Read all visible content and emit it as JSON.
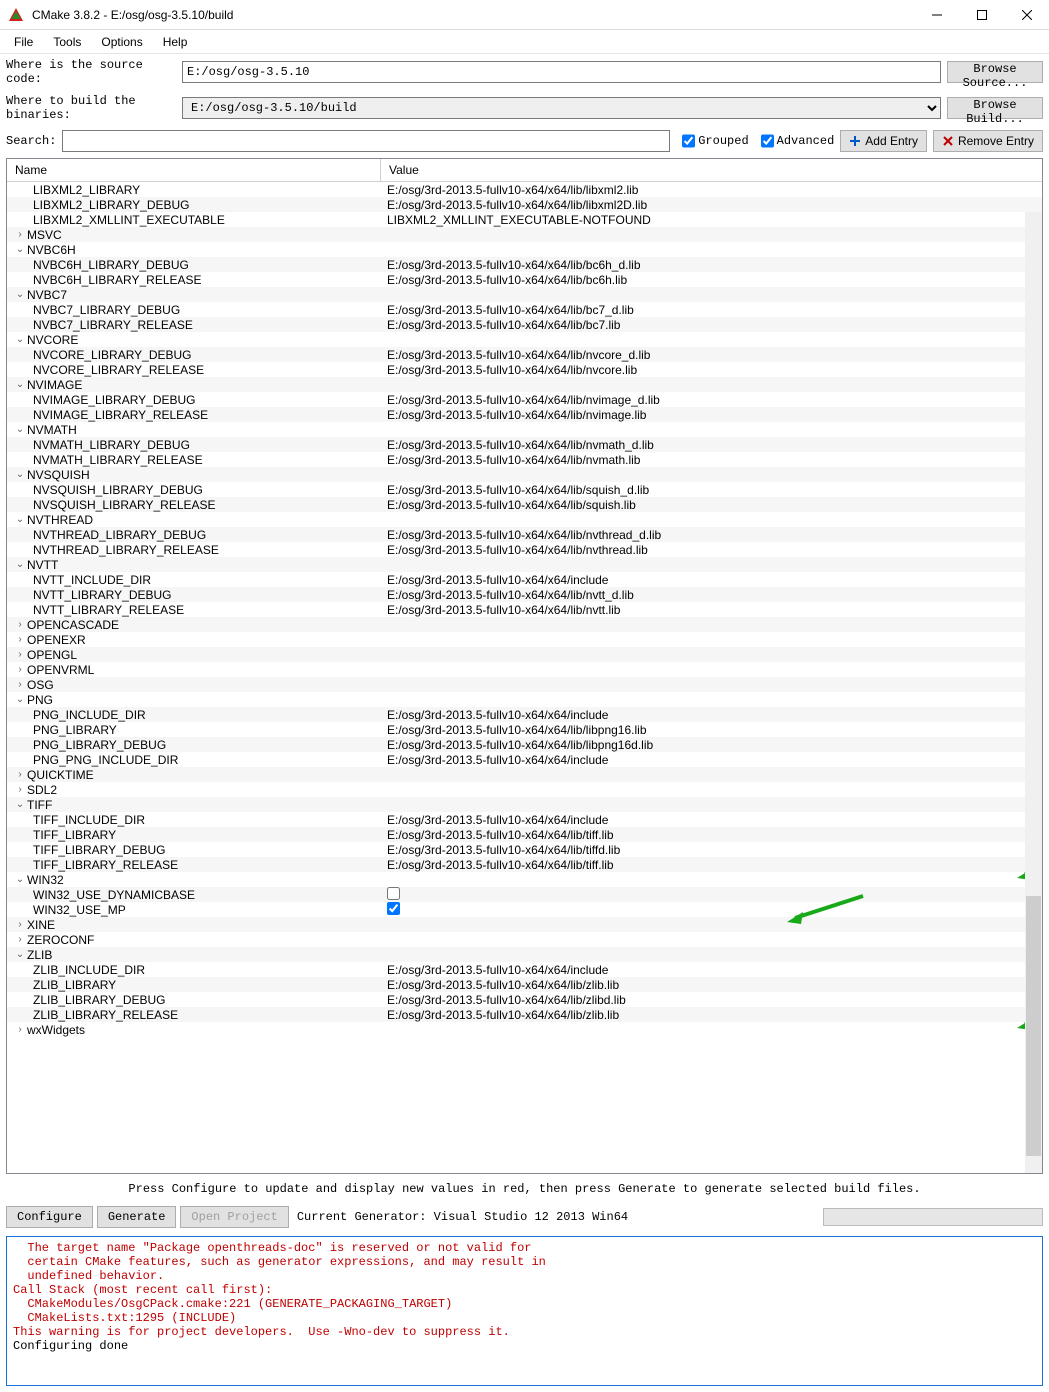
{
  "title": "CMake 3.8.2 - E:/osg/osg-3.5.10/build",
  "menu": [
    "File",
    "Tools",
    "Options",
    "Help"
  ],
  "sourceLabel": "Where is the source code:",
  "sourcePath": "E:/osg/osg-3.5.10",
  "browseSource": "Browse Source...",
  "buildLabel": "Where to build the binaries:",
  "buildPath": "E:/osg/osg-3.5.10/build",
  "browseBuild": "Browse Build...",
  "searchLabel": "Search:",
  "grouped": "Grouped",
  "advanced": "Advanced",
  "addEntry": "Add Entry",
  "removeEntry": "Remove Entry",
  "colName": "Name",
  "colValue": "Value",
  "rows": [
    {
      "indent": 2,
      "name": "LIBXML2_LIBRARY",
      "value": "E:/osg/3rd-2013.5-fullv10-x64/x64/lib/libxml2.lib"
    },
    {
      "indent": 2,
      "name": "LIBXML2_LIBRARY_DEBUG",
      "value": "E:/osg/3rd-2013.5-fullv10-x64/x64/lib/libxml2D.lib"
    },
    {
      "indent": 2,
      "name": "LIBXML2_XMLLINT_EXECUTABLE",
      "value": "LIBXML2_XMLLINT_EXECUTABLE-NOTFOUND"
    },
    {
      "indent": 1,
      "chevron": "right",
      "name": "MSVC",
      "value": ""
    },
    {
      "indent": 1,
      "chevron": "down",
      "name": "NVBC6H",
      "value": ""
    },
    {
      "indent": 2,
      "name": "NVBC6H_LIBRARY_DEBUG",
      "value": "E:/osg/3rd-2013.5-fullv10-x64/x64/lib/bc6h_d.lib"
    },
    {
      "indent": 2,
      "name": "NVBC6H_LIBRARY_RELEASE",
      "value": "E:/osg/3rd-2013.5-fullv10-x64/x64/lib/bc6h.lib"
    },
    {
      "indent": 1,
      "chevron": "down",
      "name": "NVBC7",
      "value": ""
    },
    {
      "indent": 2,
      "name": "NVBC7_LIBRARY_DEBUG",
      "value": "E:/osg/3rd-2013.5-fullv10-x64/x64/lib/bc7_d.lib"
    },
    {
      "indent": 2,
      "name": "NVBC7_LIBRARY_RELEASE",
      "value": "E:/osg/3rd-2013.5-fullv10-x64/x64/lib/bc7.lib"
    },
    {
      "indent": 1,
      "chevron": "down",
      "name": "NVCORE",
      "value": ""
    },
    {
      "indent": 2,
      "name": "NVCORE_LIBRARY_DEBUG",
      "value": "E:/osg/3rd-2013.5-fullv10-x64/x64/lib/nvcore_d.lib"
    },
    {
      "indent": 2,
      "name": "NVCORE_LIBRARY_RELEASE",
      "value": "E:/osg/3rd-2013.5-fullv10-x64/x64/lib/nvcore.lib"
    },
    {
      "indent": 1,
      "chevron": "down",
      "name": "NVIMAGE",
      "value": ""
    },
    {
      "indent": 2,
      "name": "NVIMAGE_LIBRARY_DEBUG",
      "value": "E:/osg/3rd-2013.5-fullv10-x64/x64/lib/nvimage_d.lib"
    },
    {
      "indent": 2,
      "name": "NVIMAGE_LIBRARY_RELEASE",
      "value": "E:/osg/3rd-2013.5-fullv10-x64/x64/lib/nvimage.lib"
    },
    {
      "indent": 1,
      "chevron": "down",
      "name": "NVMATH",
      "value": ""
    },
    {
      "indent": 2,
      "name": "NVMATH_LIBRARY_DEBUG",
      "value": "E:/osg/3rd-2013.5-fullv10-x64/x64/lib/nvmath_d.lib"
    },
    {
      "indent": 2,
      "name": "NVMATH_LIBRARY_RELEASE",
      "value": "E:/osg/3rd-2013.5-fullv10-x64/x64/lib/nvmath.lib"
    },
    {
      "indent": 1,
      "chevron": "down",
      "name": "NVSQUISH",
      "value": ""
    },
    {
      "indent": 2,
      "name": "NVSQUISH_LIBRARY_DEBUG",
      "value": "E:/osg/3rd-2013.5-fullv10-x64/x64/lib/squish_d.lib"
    },
    {
      "indent": 2,
      "name": "NVSQUISH_LIBRARY_RELEASE",
      "value": "E:/osg/3rd-2013.5-fullv10-x64/x64/lib/squish.lib"
    },
    {
      "indent": 1,
      "chevron": "down",
      "name": "NVTHREAD",
      "value": ""
    },
    {
      "indent": 2,
      "name": "NVTHREAD_LIBRARY_DEBUG",
      "value": "E:/osg/3rd-2013.5-fullv10-x64/x64/lib/nvthread_d.lib"
    },
    {
      "indent": 2,
      "name": "NVTHREAD_LIBRARY_RELEASE",
      "value": "E:/osg/3rd-2013.5-fullv10-x64/x64/lib/nvthread.lib"
    },
    {
      "indent": 1,
      "chevron": "down",
      "name": "NVTT",
      "value": ""
    },
    {
      "indent": 2,
      "name": "NVTT_INCLUDE_DIR",
      "value": "E:/osg/3rd-2013.5-fullv10-x64/x64/include"
    },
    {
      "indent": 2,
      "name": "NVTT_LIBRARY_DEBUG",
      "value": "E:/osg/3rd-2013.5-fullv10-x64/x64/lib/nvtt_d.lib"
    },
    {
      "indent": 2,
      "name": "NVTT_LIBRARY_RELEASE",
      "value": "E:/osg/3rd-2013.5-fullv10-x64/x64/lib/nvtt.lib"
    },
    {
      "indent": 1,
      "chevron": "right",
      "name": "OPENCASCADE",
      "value": ""
    },
    {
      "indent": 1,
      "chevron": "right",
      "name": "OPENEXR",
      "value": ""
    },
    {
      "indent": 1,
      "chevron": "right",
      "name": "OPENGL",
      "value": ""
    },
    {
      "indent": 1,
      "chevron": "right",
      "name": "OPENVRML",
      "value": ""
    },
    {
      "indent": 1,
      "chevron": "right",
      "name": "OSG",
      "value": ""
    },
    {
      "indent": 1,
      "chevron": "down",
      "name": "PNG",
      "value": ""
    },
    {
      "indent": 2,
      "name": "PNG_INCLUDE_DIR",
      "value": "E:/osg/3rd-2013.5-fullv10-x64/x64/include"
    },
    {
      "indent": 2,
      "name": "PNG_LIBRARY",
      "value": "E:/osg/3rd-2013.5-fullv10-x64/x64/lib/libpng16.lib"
    },
    {
      "indent": 2,
      "name": "PNG_LIBRARY_DEBUG",
      "value": "E:/osg/3rd-2013.5-fullv10-x64/x64/lib/libpng16d.lib"
    },
    {
      "indent": 2,
      "name": "PNG_PNG_INCLUDE_DIR",
      "value": "E:/osg/3rd-2013.5-fullv10-x64/x64/include"
    },
    {
      "indent": 1,
      "chevron": "right",
      "name": "QUICKTIME",
      "value": ""
    },
    {
      "indent": 1,
      "chevron": "right",
      "name": "SDL2",
      "value": ""
    },
    {
      "indent": 1,
      "chevron": "down",
      "name": "TIFF",
      "value": ""
    },
    {
      "indent": 2,
      "name": "TIFF_INCLUDE_DIR",
      "value": "E:/osg/3rd-2013.5-fullv10-x64/x64/include"
    },
    {
      "indent": 2,
      "name": "TIFF_LIBRARY",
      "value": "E:/osg/3rd-2013.5-fullv10-x64/x64/lib/tiff.lib"
    },
    {
      "indent": 2,
      "name": "TIFF_LIBRARY_DEBUG",
      "value": "E:/osg/3rd-2013.5-fullv10-x64/x64/lib/tiffd.lib"
    },
    {
      "indent": 2,
      "name": "TIFF_LIBRARY_RELEASE",
      "value": "E:/osg/3rd-2013.5-fullv10-x64/x64/lib/tiff.lib",
      "arrow": true
    },
    {
      "indent": 1,
      "chevron": "down",
      "name": "WIN32",
      "value": ""
    },
    {
      "indent": 2,
      "name": "WIN32_USE_DYNAMICBASE",
      "value": "",
      "checkbox": false
    },
    {
      "indent": 2,
      "name": "WIN32_USE_MP",
      "value": "",
      "checkbox": true,
      "arrow": true
    },
    {
      "indent": 1,
      "chevron": "right",
      "name": "XINE",
      "value": ""
    },
    {
      "indent": 1,
      "chevron": "right",
      "name": "ZEROCONF",
      "value": ""
    },
    {
      "indent": 1,
      "chevron": "down",
      "name": "ZLIB",
      "value": ""
    },
    {
      "indent": 2,
      "name": "ZLIB_INCLUDE_DIR",
      "value": "E:/osg/3rd-2013.5-fullv10-x64/x64/include"
    },
    {
      "indent": 2,
      "name": "ZLIB_LIBRARY",
      "value": "E:/osg/3rd-2013.5-fullv10-x64/x64/lib/zlib.lib"
    },
    {
      "indent": 2,
      "name": "ZLIB_LIBRARY_DEBUG",
      "value": "E:/osg/3rd-2013.5-fullv10-x64/x64/lib/zlibd.lib"
    },
    {
      "indent": 2,
      "name": "ZLIB_LIBRARY_RELEASE",
      "value": "E:/osg/3rd-2013.5-fullv10-x64/x64/lib/zlib.lib",
      "arrow": true
    },
    {
      "indent": 1,
      "chevron": "right",
      "name": "wxWidgets",
      "value": ""
    }
  ],
  "hint": "Press Configure to update and display new values in red, then press Generate to generate selected build files.",
  "btnConfigure": "Configure",
  "btnGenerate": "Generate",
  "btnOpenProject": "Open Project",
  "generatorLabel": "Current Generator: Visual Studio 12 2013 Win64",
  "outputLines": [
    {
      "text": "  The target name \"Package openthreads-doc\" is reserved or not valid for",
      "red": true
    },
    {
      "text": "  certain CMake features, such as generator expressions, and may result in",
      "red": true
    },
    {
      "text": "  undefined behavior.",
      "red": true
    },
    {
      "text": "Call Stack (most recent call first):",
      "red": true
    },
    {
      "text": "  CMakeModules/OsgCPack.cmake:221 (GENERATE_PACKAGING_TARGET)",
      "red": true
    },
    {
      "text": "  CMakeLists.txt:1295 (INCLUDE)",
      "red": true
    },
    {
      "text": "This warning is for project developers.  Use -Wno-dev to suppress it.",
      "red": true
    },
    {
      "text": "",
      "red": false
    },
    {
      "text": "Configuring done",
      "red": false
    }
  ]
}
